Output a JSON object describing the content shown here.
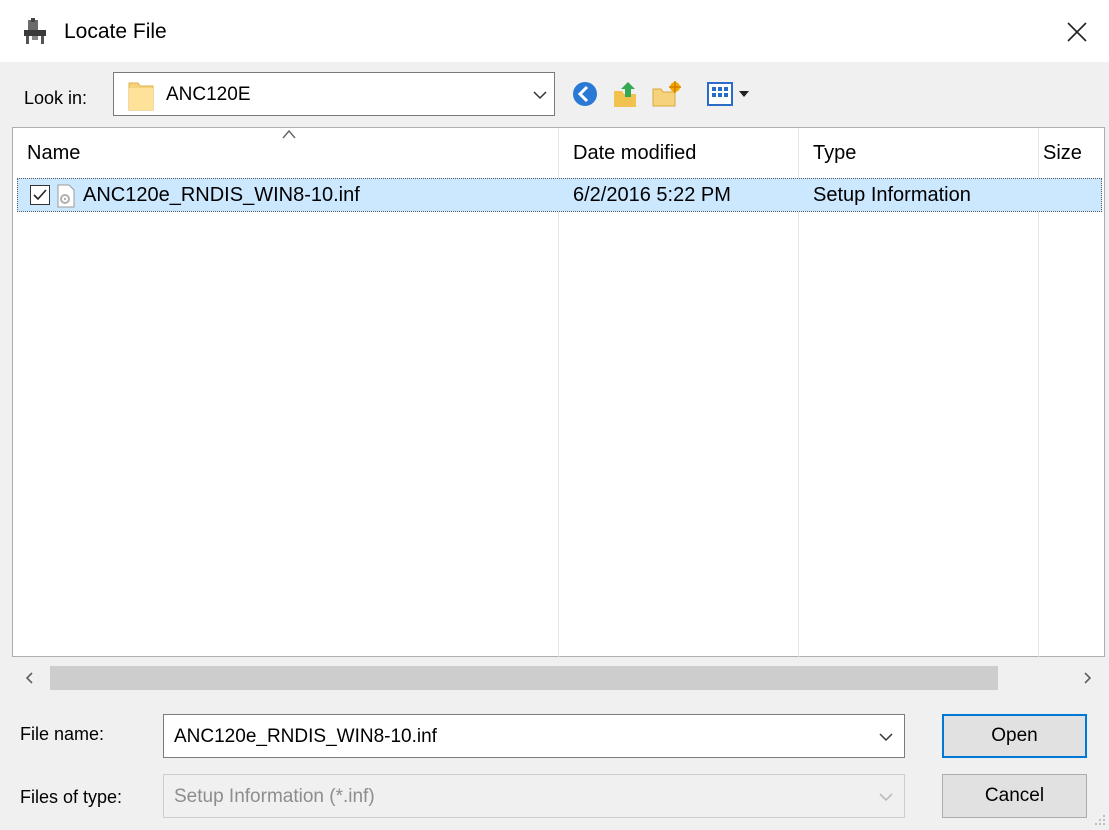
{
  "window": {
    "title": "Locate File",
    "close_glyph": "✕"
  },
  "lookin": {
    "label": "Look in:",
    "value": "ANC120E"
  },
  "toolbar": {
    "buttons": [
      {
        "icon": "back-icon"
      },
      {
        "icon": "up-folder-icon"
      },
      {
        "icon": "new-folder-icon"
      },
      {
        "icon": "view-menu-icon"
      }
    ]
  },
  "list": {
    "columns": [
      "Name",
      "Date modified",
      "Type",
      "Size"
    ],
    "rows": [
      {
        "name": "ANC120e_RNDIS_WIN8-10.inf",
        "date": "6/2/2016 5:22 PM",
        "type": "Setup Information",
        "size": "",
        "checked": true,
        "selected": true
      }
    ]
  },
  "scroll": {
    "left_glyph": "<",
    "right_glyph": ">"
  },
  "filename": {
    "label": "File name:",
    "value": "ANC120e_RNDIS_WIN8-10.inf"
  },
  "filetype": {
    "label": "Files of type:",
    "value": "Setup Information (*.inf)"
  },
  "buttons": {
    "open": "Open",
    "cancel": "Cancel"
  },
  "colors": {
    "selection": "#cce8ff",
    "accent": "#0078d7"
  }
}
